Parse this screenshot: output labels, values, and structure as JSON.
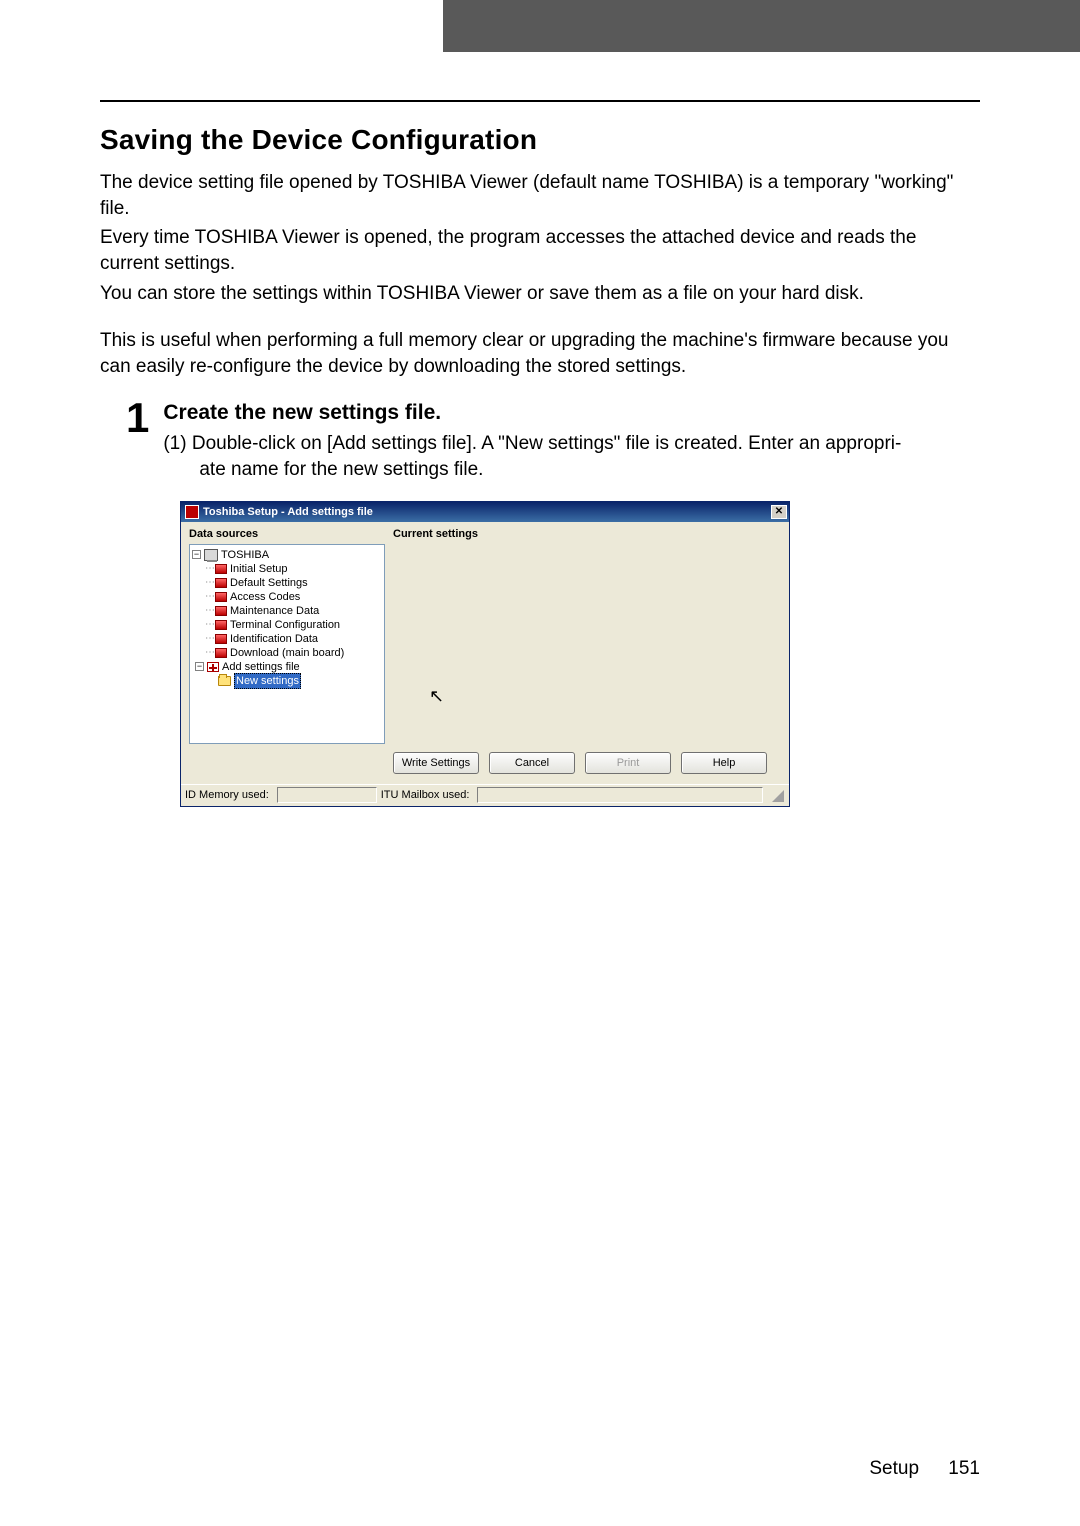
{
  "header": {
    "section_title": "Saving the Device Configuration",
    "p1": "The device setting file opened by TOSHIBA Viewer (default name TOSHIBA) is a temporary \"working\" file.",
    "p2": "Every time TOSHIBA Viewer is opened, the program accesses the attached device and reads the current settings.",
    "p3": "You can store the settings within TOSHIBA Viewer or save them as a file on your hard disk.",
    "p4": "This is useful when performing a full memory clear or upgrading the machine's firmware because you can easily re-configure the device by downloading the stored settings."
  },
  "step": {
    "number": "1",
    "title": "Create the new settings file.",
    "sub_prefix": "(1)",
    "sub_line1": "Double-click on [Add settings file]. A \"New settings\" file is created. Enter an appropri-",
    "sub_line2": "ate name for the new settings file."
  },
  "dialog": {
    "title": "Toshiba Setup - Add settings file",
    "left_header": "Data sources",
    "right_header": "Current settings",
    "tree": {
      "root": "TOSHIBA",
      "items": [
        "Initial Setup",
        "Default Settings",
        "Access Codes",
        "Maintenance Data",
        "Terminal Configuration",
        "Identification Data",
        "Download (main board)"
      ],
      "add_item": "Add settings file",
      "new_item": "New settings"
    },
    "buttons": {
      "write": "Write Settings",
      "cancel": "Cancel",
      "print": "Print",
      "help": "Help"
    },
    "status": {
      "id_memory": "ID Memory used:",
      "itu_mailbox": "ITU Mailbox used:"
    },
    "close_glyph": "✕"
  },
  "footer": {
    "section": "Setup",
    "page": "151"
  }
}
